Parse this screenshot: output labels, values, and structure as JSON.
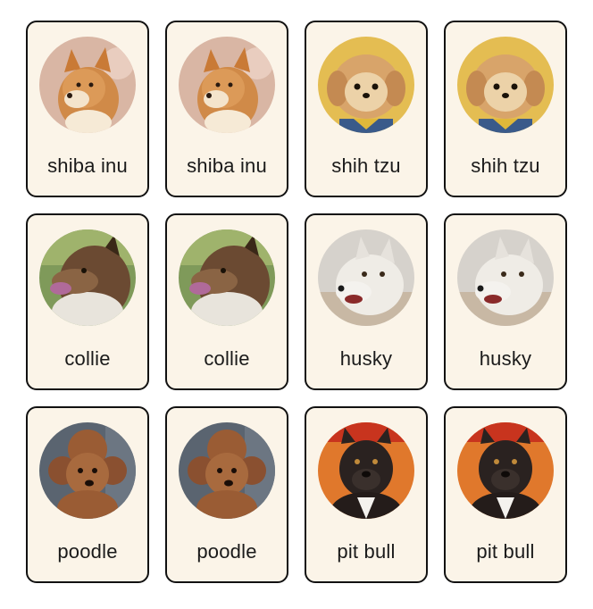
{
  "cards": [
    {
      "label": "shiba inu",
      "icon": "shiba-inu-photo"
    },
    {
      "label": "shiba inu",
      "icon": "shiba-inu-photo"
    },
    {
      "label": "shih tzu",
      "icon": "shih-tzu-photo"
    },
    {
      "label": "shih tzu",
      "icon": "shih-tzu-photo"
    },
    {
      "label": "collie",
      "icon": "collie-photo"
    },
    {
      "label": "collie",
      "icon": "collie-photo"
    },
    {
      "label": "husky",
      "icon": "husky-photo"
    },
    {
      "label": "husky",
      "icon": "husky-photo"
    },
    {
      "label": "poodle",
      "icon": "poodle-photo"
    },
    {
      "label": "poodle",
      "icon": "poodle-photo"
    },
    {
      "label": "pit bull",
      "icon": "pit-bull-photo"
    },
    {
      "label": "pit bull",
      "icon": "pit-bull-photo"
    }
  ],
  "colors": {
    "card_background": "#fbf4e8",
    "card_border": "#111111"
  }
}
